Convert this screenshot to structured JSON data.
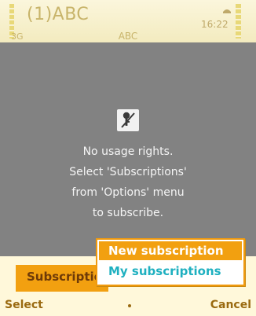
{
  "status_bar": {
    "title": "(1)ABC",
    "network": "3G",
    "operator": "ABC",
    "time": "16:22",
    "signal_icon": "signal-bars-icon",
    "battery_icon": "battery-bars-icon"
  },
  "content": {
    "icon": "no-rights-icon",
    "lines": [
      "No usage rights.",
      "Select 'Subscriptions'",
      "from 'Options' menu",
      "to subscribe."
    ]
  },
  "tab": {
    "label": "Subscriptions"
  },
  "menu": {
    "items": [
      {
        "label": "New subscription",
        "selected": true
      },
      {
        "label": "My subscriptions",
        "selected": false
      }
    ]
  },
  "softkeys": {
    "left": "Select",
    "right": "Cancel"
  },
  "colors": {
    "accent": "#f2a010",
    "content_bg": "#828282",
    "link": "#1fb0c0"
  }
}
